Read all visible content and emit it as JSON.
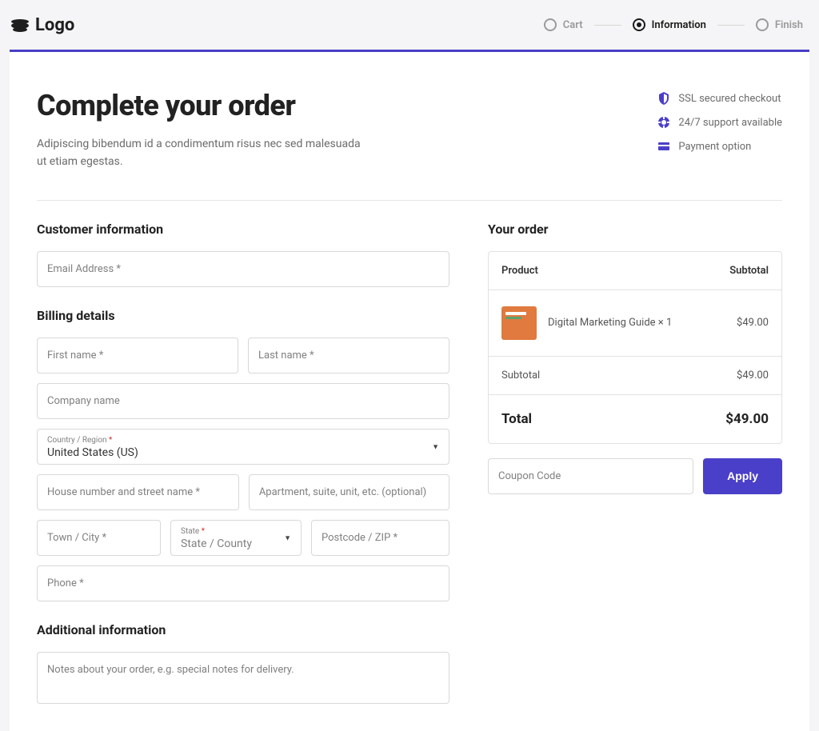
{
  "header": {
    "logo_text": "Logo",
    "steps": [
      {
        "label": "Cart",
        "active": false
      },
      {
        "label": "Information",
        "active": true
      },
      {
        "label": "Finish",
        "active": false
      }
    ]
  },
  "hero": {
    "title": "Complete your order",
    "description": "Adipiscing bibendum id a condimentum risus nec sed malesuada ut etiam egestas."
  },
  "trust": {
    "ssl": "SSL secured checkout",
    "support": "24/7 support available",
    "payment": "Payment option"
  },
  "sections": {
    "customer": "Customer information",
    "billing": "Billing details",
    "additional": "Additional information",
    "order": "Your order"
  },
  "fields": {
    "email_ph": "Email Address *",
    "first_name_ph": "First name *",
    "last_name_ph": "Last name *",
    "company_ph": "Company name",
    "country_label": "Country / Region",
    "country_value": "United States (US)",
    "street_ph": "House number and street name *",
    "apt_ph": "Apartment, suite, unit, etc. (optional)",
    "city_ph": "Town / City *",
    "state_label": "State",
    "state_value": "State / County",
    "zip_ph": "Postcode / ZIP *",
    "phone_ph": "Phone *",
    "notes_ph": "Notes about your order, e.g. special notes for delivery.",
    "coupon_ph": "Coupon Code"
  },
  "order": {
    "head_product": "Product",
    "head_subtotal": "Subtotal",
    "item_name": "Digital Marketing Guide × 1",
    "item_price": "$49.00",
    "subtotal_label": "Subtotal",
    "subtotal_value": "$49.00",
    "total_label": "Total",
    "total_value": "$49.00"
  },
  "buttons": {
    "apply": "Apply"
  }
}
